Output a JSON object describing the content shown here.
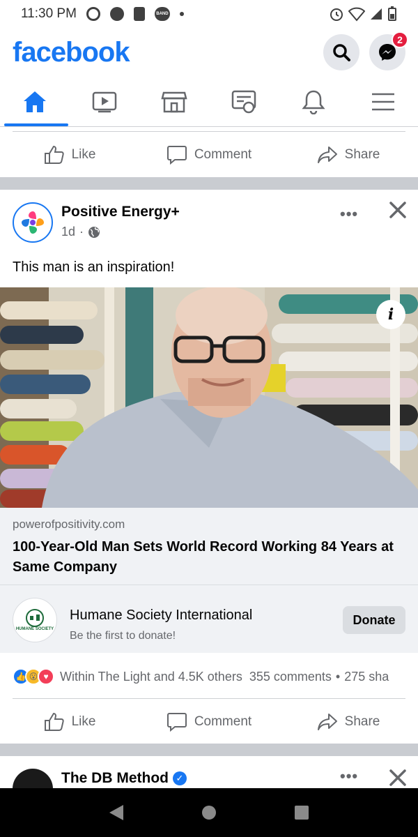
{
  "status_bar": {
    "time": "11:30 PM"
  },
  "header": {
    "logo": "facebook",
    "messenger_badge": "2"
  },
  "nav": {
    "tabs": [
      "home",
      "watch",
      "marketplace",
      "news-feed",
      "notifications",
      "menu"
    ]
  },
  "top_actions": {
    "like": "Like",
    "comment": "Comment",
    "share": "Share"
  },
  "post": {
    "author": "Positive Energy+",
    "time": "1d",
    "text": "This man is an inspiration!",
    "link_domain": "powerofpositivity.com",
    "link_title": "100-Year-Old Man Sets World Record Working 84 Years at Same Company",
    "donation": {
      "org_name": "Humane Society International",
      "subtitle": "Be the first to donate!",
      "button": "Donate",
      "logo_text": "HUMANE SOCIETY"
    },
    "reactions_text": "Within The Light and 4.5K others",
    "comments": "355 comments",
    "shares": "275 sha",
    "actions": {
      "like": "Like",
      "comment": "Comment",
      "share": "Share"
    }
  },
  "next_post": {
    "author": "The DB Method"
  },
  "colors": {
    "brand": "#1877f2",
    "badge": "#e41e3f",
    "separator": "#c9ccd1",
    "link_box": "#f0f2f5"
  }
}
